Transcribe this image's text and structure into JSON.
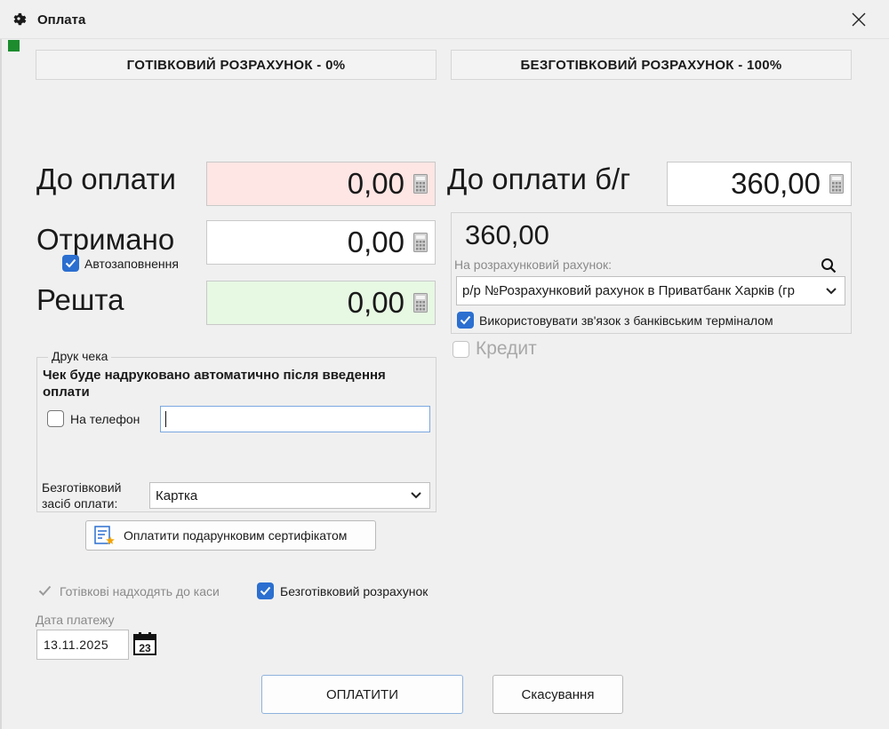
{
  "window": {
    "title": "Оплата"
  },
  "modes": {
    "cash": "ГОТІВКОВИЙ РОЗРАХУНОК - 0%",
    "cashless": "БЕЗГОТІВКОВИЙ РОЗРАХУНОК - 100%"
  },
  "cash": {
    "to_pay_label": "До оплати",
    "to_pay_value": "0,00",
    "received_label": "Отримано",
    "received_value": "0,00",
    "autofill_label": "Автозаповнення",
    "autofill_checked": true,
    "change_label": "Решта",
    "change_value": "0,00"
  },
  "cashless": {
    "to_pay_label": "До оплати б/г",
    "to_pay_value": "360,00",
    "amount_display": "360,00",
    "account_label": "На розрахунковий рахунок:",
    "account_value": "р/р №Розрахунковий рахунок в Приватбанк Харків (гр",
    "terminal_label": "Використовувати зв'язок з банківським терміналом",
    "terminal_checked": true,
    "credit_label": "Кредит",
    "credit_checked": false
  },
  "receipt": {
    "group_title": "Друк чека",
    "info_text": "Чек буде надруковано автоматично після введення оплати",
    "phone_label": "На телефон",
    "phone_value": "",
    "cashless_method_label": "Безготівковий засіб оплати:",
    "cashless_method_value": "Картка"
  },
  "gift_cert_button": "Оплатити подарунковим сертифікатом",
  "options": {
    "cash_to_register_label": "Готівкові надходять до каси",
    "cash_to_register_checked": true,
    "cashless_label": "Безготівковий розрахунок",
    "cashless_checked": true
  },
  "payment_date": {
    "label": "Дата платежу",
    "value": "13.11.2025",
    "calendar_day": "23"
  },
  "actions": {
    "pay": "ОПЛАТИТИ",
    "cancel": "Скасування"
  },
  "colors": {
    "to_pay_bg": "#fde6e4",
    "change_bg": "#e7f8e3",
    "checkbox_accent": "#2b6fd0",
    "status_green": "#1c8c2e"
  },
  "icons": {
    "window": "gear-icon",
    "close": "close-icon",
    "calculator": "calculator-icon",
    "search": "search-icon",
    "dropdown": "chevron-down-icon",
    "certificate": "certificate-icon",
    "calendar": "calendar-icon"
  }
}
